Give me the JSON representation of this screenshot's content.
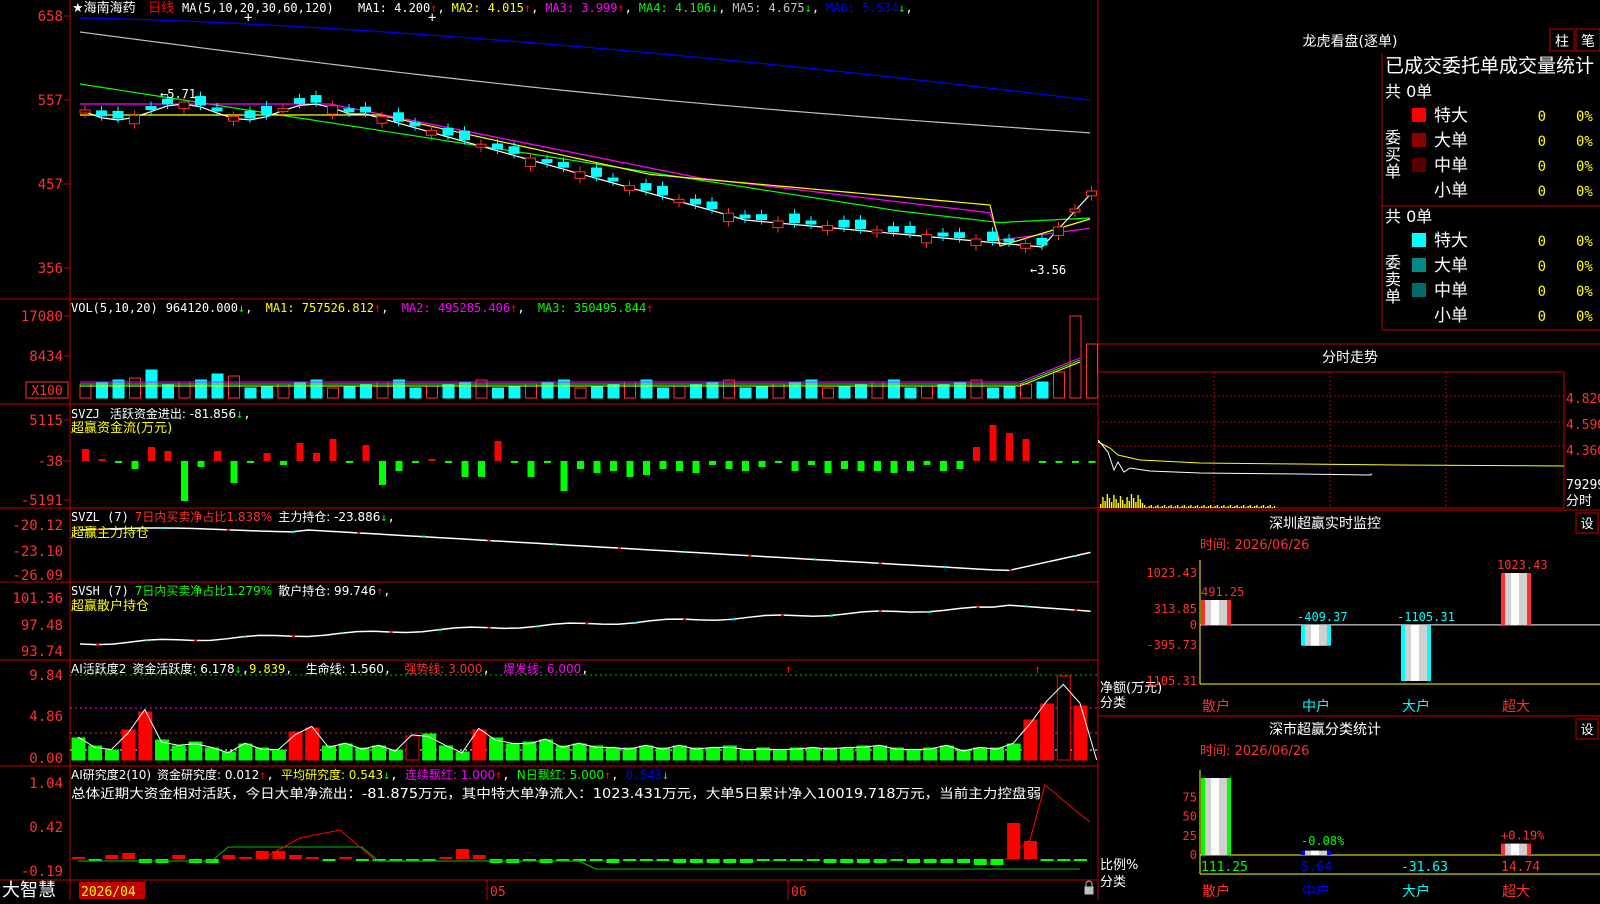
{
  "app": {
    "brand": "大智慧"
  },
  "header": {
    "stock": "★海南海药",
    "period": "日线",
    "ma_params": "MA(5,10,20,30,60,120)",
    "mas": [
      {
        "label": "MA1: 4.200",
        "arrow": "↑",
        "color": "#ffffff"
      },
      {
        "label": "MA2: 4.015",
        "arrow": "↑",
        "color": "#ffff00"
      },
      {
        "label": "MA3: 3.999",
        "arrow": "↑",
        "color": "#ff00ff"
      },
      {
        "label": "MA4: 4.106",
        "arrow": "↓",
        "color": "#00ff00"
      },
      {
        "label": "MA5: 4.675",
        "arrow": "↓",
        "color": "#c0c0c0"
      },
      {
        "label": "MA6: 5.534",
        "arrow": "↓",
        "color": "#0000ff"
      }
    ]
  },
  "price_axis": [
    "658",
    "557",
    "457",
    "356"
  ],
  "price_marks": {
    "high": "5.71",
    "low": "3.56"
  },
  "vol": {
    "params": "VOL(5,10,20)",
    "value": "964120.000",
    "value_arrow": "↓",
    "ma1": "MA1: 757526.812",
    "ma1_arrow": "↑",
    "ma2": "MA2: 495285.406",
    "ma2_arrow": "↑",
    "ma3": "MA3: 350495.844",
    "ma3_arrow": "↑",
    "axis": [
      "17080",
      "8434"
    ],
    "unit": "X100"
  },
  "svzj": {
    "name": "SVZJ",
    "label": "活跃资金进出: -81.856",
    "arrow": "↓",
    "sub": "超赢资金流(万元)",
    "axis": [
      "5115",
      "-38",
      "-5191"
    ]
  },
  "svzl": {
    "name": "SVZL (7)",
    "note": "7日内买卖净占比1.838%",
    "label": "主力持仓: -23.886",
    "arrow": "↓",
    "sub": "超赢主力持仓",
    "axis": [
      "-20.12",
      "-23.10",
      "-26.09"
    ]
  },
  "svsh": {
    "name": "SVSH (7)",
    "note": "7日内买卖净占比1.279%",
    "label": "散户持仓: 99.746",
    "arrow": "↑",
    "sub": "超赢散户持仓",
    "axis": [
      "101.36",
      "97.48",
      "93.74"
    ]
  },
  "ai1": {
    "name": "AI活跃度2",
    "a": "资金活跃度: 6.178",
    "a_arrow": "↓",
    "b": "9.839",
    "c": "生命线: 1.560",
    "d": "强势线: 3.000",
    "e": "爆发线: 6.000",
    "axis": [
      "9.84",
      "4.86",
      "0.00"
    ]
  },
  "ai2": {
    "name": "AI研究度2(10)",
    "a": "资金研究度: 0.012",
    "a_arrow": "↑",
    "b": "平均研究度: 0.543",
    "b_arrow": "↓",
    "c": "连续飘红: 1.000",
    "c_arrow": "↑",
    "d": "N日飘红: 5.000",
    "d_arrow": "↑",
    "e": "0.543",
    "e_arrow": "↓",
    "summary": "总体近期大资金相对活跃，今日大单净流出：-81.875万元，其中特大单净流入：1023.431万元，大单5日累计净入10019.718万元，当前主力控盘弱",
    "axis": [
      "1.04",
      "0.42",
      "-0.19"
    ]
  },
  "date_axis": {
    "first": "2026/04",
    "m05": "05",
    "m06": "06"
  },
  "longhu": {
    "title": "龙虎看盘(逐单)",
    "btn_bar": "柱",
    "btn_pen": "笔",
    "section": "已成交委托单成交量统计",
    "buy": {
      "side": "委买单",
      "total": "共 0单",
      "rows": [
        {
          "name": "特大",
          "count": "0",
          "pct": "0%",
          "color": "#ff0000"
        },
        {
          "name": "大单",
          "count": "0",
          "pct": "0%",
          "color": "#8b0000"
        },
        {
          "name": "中单",
          "count": "0",
          "pct": "0%",
          "color": "#5a0000"
        },
        {
          "name": "小单",
          "count": "0",
          "pct": "0%",
          "color": ""
        }
      ]
    },
    "sell": {
      "side": "委卖单",
      "total": "共 0单",
      "rows": [
        {
          "name": "特大",
          "count": "0",
          "pct": "0%",
          "color": "#00ffff"
        },
        {
          "name": "大单",
          "count": "0",
          "pct": "0%",
          "color": "#008b8b"
        },
        {
          "name": "中单",
          "count": "0",
          "pct": "0%",
          "color": "#006b6b"
        },
        {
          "name": "小单",
          "count": "0",
          "pct": "0%",
          "color": ""
        }
      ]
    }
  },
  "fenshi": {
    "title": "分时走势",
    "axis": [
      "4.820",
      "4.590",
      "4.360",
      "79299"
    ],
    "label": "分时"
  },
  "monitor": {
    "title": "深圳超赢实时监控",
    "btn": "设",
    "time": "时间: 2026/06/26",
    "axis": [
      "1023.43",
      "313.85",
      "0",
      "-395.73",
      "-1105.31"
    ],
    "values": [
      {
        "cat": "散户",
        "value": 491.25,
        "label": "491.25"
      },
      {
        "cat": "中户",
        "value": -409.37,
        "label": "-409.37"
      },
      {
        "cat": "大户",
        "value": -1105.31,
        "label": "-1105.31"
      },
      {
        "cat": "超大",
        "value": 1023.43,
        "label": "1023.43"
      }
    ],
    "ylabel_1": "净额(万元)",
    "ylabel_2": "分类"
  },
  "classify": {
    "title": "深市超赢分类统计",
    "btn": "设",
    "time": "时间: 2026/06/26",
    "axis": [
      "75",
      "50",
      "25",
      "0"
    ],
    "values": [
      {
        "cat": "散户",
        "value": 111.25,
        "label": "111.25",
        "pct": ""
      },
      {
        "cat": "中户",
        "value": 5.64,
        "label": "5.64",
        "pct": "-0.08%"
      },
      {
        "cat": "大户",
        "value": -31.63,
        "label": "-31.63",
        "pct": ""
      },
      {
        "cat": "超大",
        "value": 14.74,
        "label": "14.74",
        "pct": "+0.19%"
      }
    ],
    "ylabel_1": "比例%",
    "ylabel_2": "分类"
  },
  "chart_data": {
    "type": "bar",
    "title": "深圳超赢实时监控",
    "categories": [
      "散户",
      "中户",
      "大户",
      "超大"
    ],
    "values": [
      491.25,
      -409.37,
      -1105.31,
      1023.43
    ],
    "ylabel": "净额(万元)",
    "ylim": [
      -1105.31,
      1023.43
    ]
  }
}
